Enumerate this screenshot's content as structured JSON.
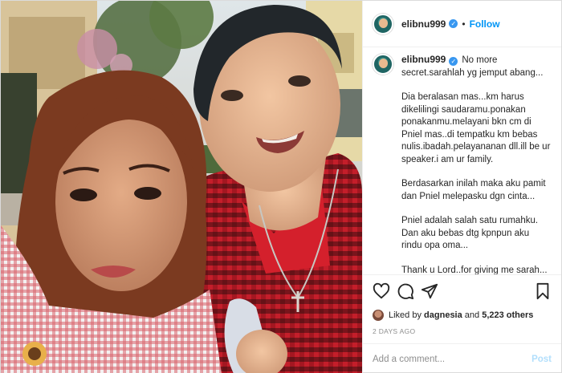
{
  "header": {
    "username": "elibnu999",
    "separator": "•",
    "follow_label": "Follow"
  },
  "caption": {
    "username": "elibnu999",
    "paragraphs": [
      "No more secret.sarahlah yg jemput abang...",
      "Dia beralasan mas...km harus dikelilingi saudaramu.ponakan ponakanmu.melayani bkn cm di Pniel mas..di tempatku km bebas nulis.ibadah.pelayananan dll.ill be ur speaker.i am ur family.",
      "Berdasarkan inilah maka aku pamit dan Pniel melepasku dgn cinta...",
      "Pniel adalah salah satu rumahku. Dan aku bebas dtg kpnpun aku rindu opa oma...",
      "Thank u Lord..for giving me sarah..."
    ]
  },
  "likes": {
    "prefix": "Liked by",
    "first_user": "dagnesia",
    "joiner": "and",
    "others": "5,223 others"
  },
  "timestamp": "2 DAYS AGO",
  "comment": {
    "placeholder": "Add a comment...",
    "value": "",
    "post_label": "Post"
  },
  "icons": {
    "like": "heart-icon",
    "comment": "comment-icon",
    "share": "share-icon",
    "save": "bookmark-icon",
    "verified": "verified-badge-icon"
  },
  "colors": {
    "accent": "#0095f6",
    "verified": "#3897f0",
    "muted": "#8e8e8e",
    "post_disabled": "#b2dffc",
    "shirt_red": "#d4202c"
  }
}
